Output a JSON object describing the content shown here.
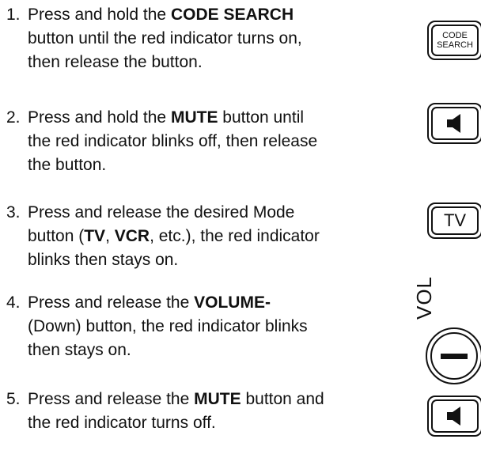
{
  "steps": [
    {
      "number": "1.",
      "lines": [
        [
          "Press and hold the ",
          {
            "b": "CODE SEARCH"
          }
        ],
        [
          "button until the red indicator turns on,"
        ],
        [
          "then release the button."
        ]
      ]
    },
    {
      "number": "2.",
      "lines": [
        [
          "Press and hold the ",
          {
            "b": "MUTE"
          },
          " button until"
        ],
        [
          "the red indicator blinks off, then release"
        ],
        [
          "the button."
        ]
      ]
    },
    {
      "number": "3.",
      "lines": [
        [
          "Press and release the desired Mode"
        ],
        [
          "button (",
          {
            "b": "TV"
          },
          ", ",
          {
            "b": "VCR"
          },
          ", etc.), the red indicator"
        ],
        [
          "blinks then stays on."
        ]
      ]
    },
    {
      "number": "4.",
      "lines": [
        [
          "Press and release the ",
          {
            "b": "VOLUME-"
          }
        ],
        [
          "(Down) button, the red indicator blinks"
        ],
        [
          "then stays on."
        ]
      ]
    },
    {
      "number": "5.",
      "lines": [
        [
          "Press and release the ",
          {
            "b": "MUTE"
          },
          " button and"
        ],
        [
          "the red indicator turns off."
        ]
      ]
    }
  ],
  "buttons": {
    "code_search_line1": "CODE",
    "code_search_line2": "SEARCH",
    "tv_label": "TV",
    "vol_label": "VOL",
    "mute_icon": "speaker-mute-icon",
    "minus_icon": "minus-icon"
  }
}
